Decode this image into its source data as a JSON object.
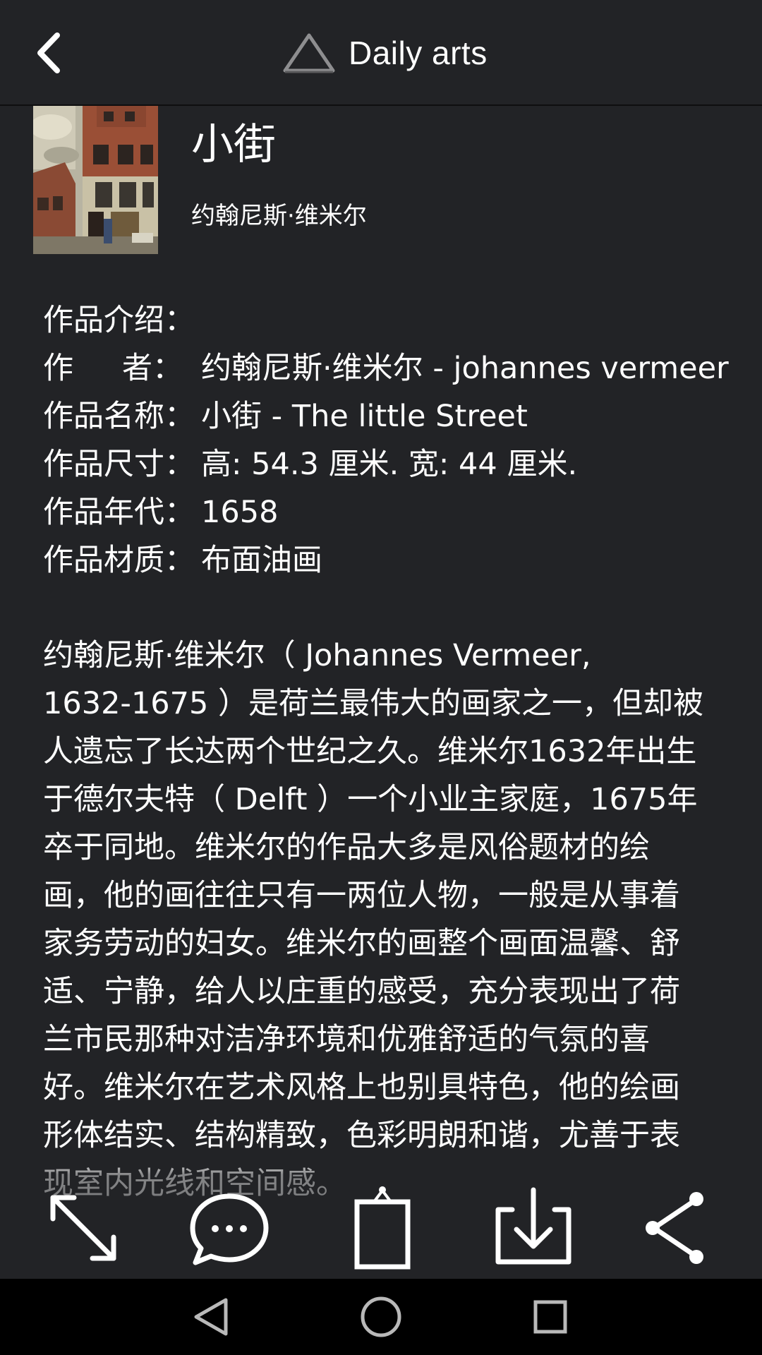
{
  "app_bar": {
    "title": "Daily arts",
    "back_icon": "chevron-left-icon",
    "logo_icon": "triangle-logo-icon"
  },
  "artwork": {
    "title": "小街",
    "artist": "约翰尼斯·维米尔"
  },
  "info": {
    "heading": "作品介绍：",
    "rows": [
      {
        "label_a": "作",
        "label_b": "者：",
        "value": "约翰尼斯·维米尔 - johannes vermeer"
      },
      {
        "label": "作品名称：",
        "value": "小街 - The little Street"
      },
      {
        "label": "作品尺寸：",
        "value": "高: 54.3 厘米. 宽: 44 厘米."
      },
      {
        "label": "作品年代：",
        "value": "1658"
      },
      {
        "label": "作品材质：",
        "value": "布面油画"
      }
    ]
  },
  "bio_lines": [
    "约翰尼斯·维米尔（ Johannes Vermeer,",
    "1632-1675 ）是荷兰最伟大的画家之一，但却被",
    "人遗忘了长达两个世纪之久。维米尔1632年出生",
    "于德尔夫特（ Delft ）一个小业主家庭，1675年",
    "卒于同地。维米尔的作品大多是风俗题材的绘",
    "画，他的画往往只有一两位人物，一般是从事着",
    "家务劳动的妇女。维米尔的画整个画面温馨、舒",
    "适、宁静，给人以庄重的感受，充分表现出了荷",
    "兰市民那种对洁净环境和优雅舒适的气氛的喜",
    "好。维米尔在艺术风格上也别具特色，他的绘画",
    "形体结实、结构精致，色彩明朗和谐，尤善于表",
    "现室内光线和空间感。"
  ],
  "actions": [
    {
      "icon": "fullscreen-icon"
    },
    {
      "icon": "comment-icon"
    },
    {
      "icon": "wallpaper-frame-icon"
    },
    {
      "icon": "download-icon"
    },
    {
      "icon": "share-icon"
    }
  ],
  "system_nav": [
    {
      "icon": "back-triangle-icon"
    },
    {
      "icon": "home-circle-icon"
    },
    {
      "icon": "recents-square-icon"
    }
  ],
  "colors": {
    "background": "#222326",
    "text": "#ffffff",
    "nav_bar": "#000000"
  }
}
